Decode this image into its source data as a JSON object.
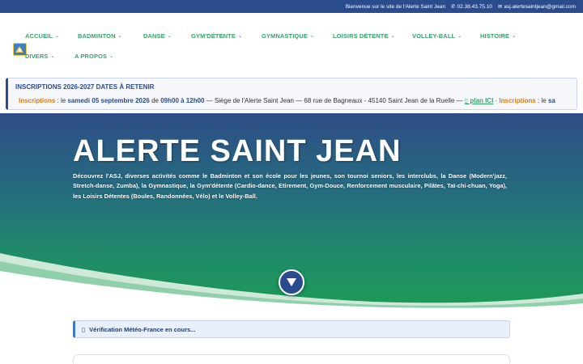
{
  "topbar": {
    "welcome": "Bienvenue sur le site de l'Alerte Saint Jean",
    "phone_icon": "phone-icon",
    "phone": "02.38.43.75.10",
    "mail_icon": "envelope-icon",
    "email": "asj.alertesaintjean@gmail.com"
  },
  "nav": {
    "items": [
      {
        "label": "ACCUEIL"
      },
      {
        "label": "BADMINTON"
      },
      {
        "label": "DANSE"
      },
      {
        "label": "GYM'DÉTENTE"
      },
      {
        "label": "GYMNASTIQUE"
      },
      {
        "label": "LOISIRS DÉTENTE"
      },
      {
        "label": "VOLLEY-BALL"
      },
      {
        "label": "HISTOIRE"
      },
      {
        "label": "DIVERS"
      },
      {
        "label": "A PROPOS"
      }
    ]
  },
  "banner": {
    "title": "INSCRIPTIONS 2026-2027 DATES À RETENIR",
    "ticker": {
      "label1": "Inscriptions",
      "text1": " : le ",
      "date": "samedi 05 septembre 2026",
      "text2": " de ",
      "hours": "09h00 à 12h00",
      "text3": " — Siège de l'Alerte Saint Jean — 68 rue de Bagneaux - 45140 Saint Jean de la Ruelle — ",
      "link": "▯ plan ICI",
      "text4": " · ",
      "label2": "Inscriptions",
      "text5": " : le ",
      "tail": "sa"
    }
  },
  "hero": {
    "title": "ALERTE SAINT JEAN",
    "description": "Découvrez l'ASJ, diverses activités comme le Badminton et son école pour les jeunes, son tournoi seniors, les interclubs, la Danse (Modern'jazz, Stretch-danse, Zumba), la Gymnastique, la Gym'détente (Cardio-dance, Etirement, Gym-Douce, Renforcement musculaire, Pilâtes, Taï-chi-chuan, Yoga), les Loisirs Détentes (Boules, Randonnées, Vélo) et le Volley-Ball."
  },
  "meteo": {
    "icon": "info-icon",
    "text": "Vérification Météo-France en cours..."
  },
  "colors": {
    "brand_blue": "#2a4b8c",
    "nav_green": "#3aa36a",
    "accent_orange": "#e07b12"
  }
}
